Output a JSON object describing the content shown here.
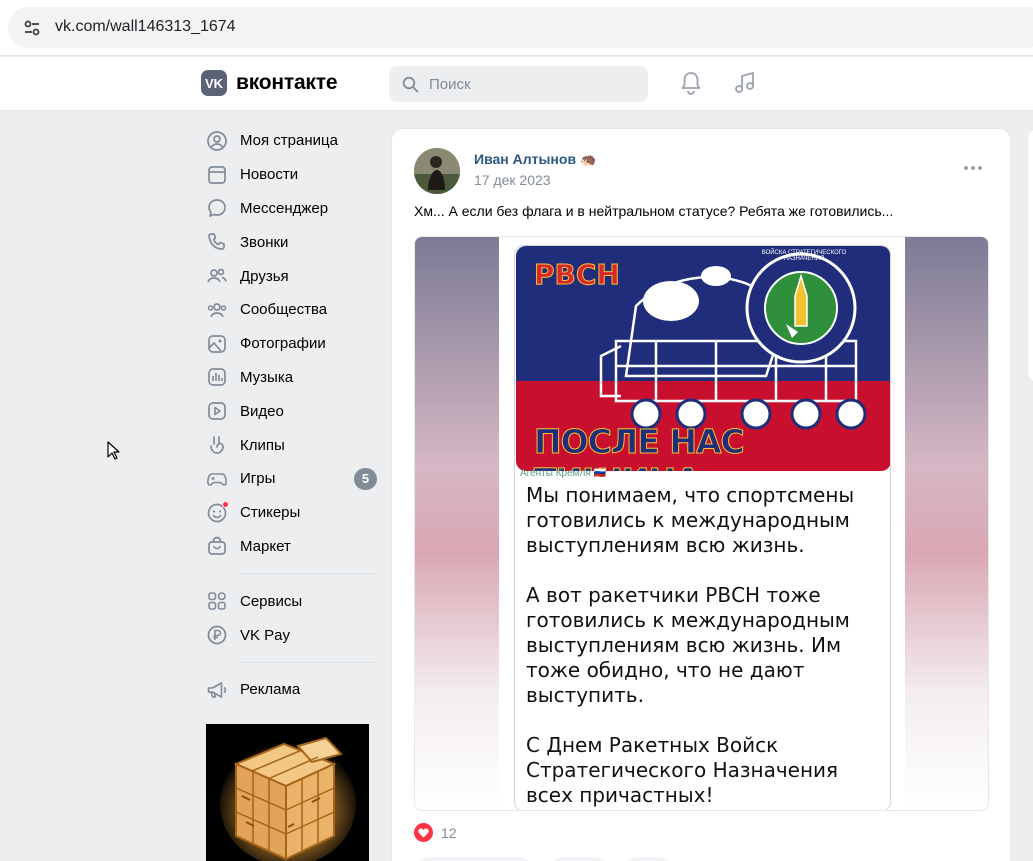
{
  "browser": {
    "url": "vk.com/wall146313_1674"
  },
  "header": {
    "logo_text": "вконтакте",
    "logo_mark": "VK",
    "search_placeholder": "Поиск"
  },
  "sidebar": {
    "items": [
      {
        "label": "Моя страница",
        "icon": "user-circle-icon"
      },
      {
        "label": "Новости",
        "icon": "news-icon"
      },
      {
        "label": "Мессенджер",
        "icon": "message-icon"
      },
      {
        "label": "Звонки",
        "icon": "phone-icon"
      },
      {
        "label": "Друзья",
        "icon": "friends-icon"
      },
      {
        "label": "Сообщества",
        "icon": "communities-icon"
      },
      {
        "label": "Фотографии",
        "icon": "photo-icon"
      },
      {
        "label": "Музыка",
        "icon": "music-icon"
      },
      {
        "label": "Видео",
        "icon": "video-icon"
      },
      {
        "label": "Клипы",
        "icon": "clips-icon"
      },
      {
        "label": "Игры",
        "icon": "games-icon",
        "badge": "5"
      },
      {
        "label": "Стикеры",
        "icon": "sticker-icon"
      },
      {
        "label": "Маркет",
        "icon": "market-icon"
      }
    ],
    "secondary": [
      {
        "label": "Сервисы",
        "icon": "services-icon"
      },
      {
        "label": "VK Pay",
        "icon": "vkpay-icon"
      }
    ],
    "tertiary": [
      {
        "label": "Реклама",
        "icon": "megaphone-icon"
      }
    ]
  },
  "post": {
    "author": "Иван Алтынов",
    "author_emoji": "🦔",
    "date": "17 дек 2023",
    "text": "Хм... А если без флага и в нейтральном статусе? Ребята же готовились...",
    "image": {
      "banner_left": "РВСН",
      "banner_bottom": "ПОСЛЕ НАС ТИШИНА",
      "emblem_text": "ВОЙСКА СТРАТЕГИЧЕСКОГО НАЗНАЧЕНИЯ",
      "source": "Агенты Кремля 🇷🇺",
      "body": "Мы понимаем, что спортсмены готовились к международным выступлениям всю жизнь.\n\nА вот ракетчики РВСН тоже готовились к международным выступлениям всю жизнь. Им тоже обидно, что не дают выступить.\n\nС Днем Ракетных Войск Стратегического Назначения всех причастных!\nПосле вас - тишина!"
    },
    "likes": "12"
  },
  "colors": {
    "link": "#2a5885",
    "badge": "#818c99",
    "like": "#ff3347",
    "banner_blue": "#1f2d7a",
    "banner_red": "#c8102e"
  }
}
